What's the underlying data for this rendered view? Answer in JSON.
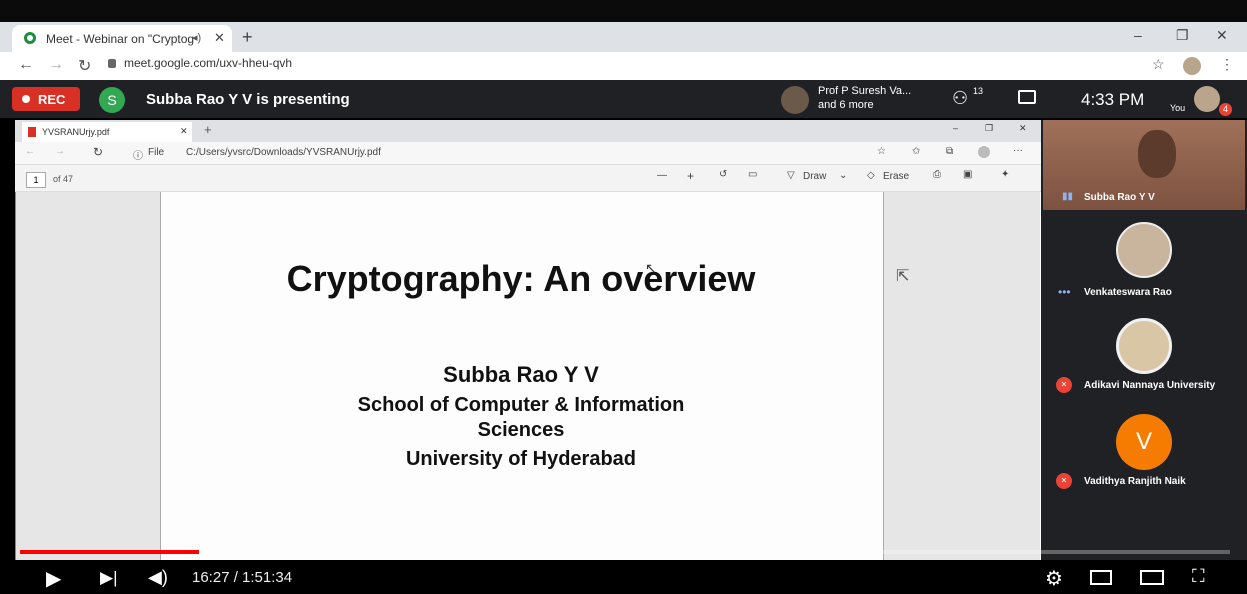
{
  "browser": {
    "tab_title": "Meet - Webinar on \"Cryptog",
    "tab_audio_icon": "speaker-icon",
    "url": "meet.google.com/uxv-hheu-qvh",
    "new_tab": "+",
    "win_min": "–",
    "win_max": "❐",
    "win_close": "✕"
  },
  "meet": {
    "rec_label": "REC",
    "presenter_initial": "S",
    "presenting_text": "Subba Rao Y V is presenting",
    "others_line1": "Prof P Suresh Va...",
    "others_line2": "and 6 more",
    "people_count": "13",
    "clock": "4:33 PM",
    "you_label": "You",
    "you_badge": "4"
  },
  "pdf_viewer": {
    "tab_title": "YVSRANUrjy.pdf",
    "address_prefix": "File",
    "file_path": "C:/Users/yvsrc/Downloads/YVSRANUrjy.pdf",
    "page_current": "1",
    "page_total": "of 47",
    "draw_label": "Draw",
    "erase_label": "Erase"
  },
  "slide": {
    "title": "Cryptography: An overview",
    "author": "Subba Rao Y V",
    "school_line1": "School of Computer & Information",
    "school_line2": "Sciences",
    "university": "University of Hyderabad"
  },
  "participants": [
    {
      "name": "Subba Rao Y V",
      "status": "speaking"
    },
    {
      "name": "Venkateswara Rao",
      "status": "active"
    },
    {
      "name": "Adikavi Nannaya University",
      "status": "muted"
    },
    {
      "name": "Vadithya Ranjith Naik",
      "status": "muted",
      "initial": "V"
    }
  ],
  "player": {
    "current_time": "16:27",
    "duration": "1:51:34",
    "time_display": "16:27 / 1:51:34",
    "progress_fraction": 0.148
  }
}
